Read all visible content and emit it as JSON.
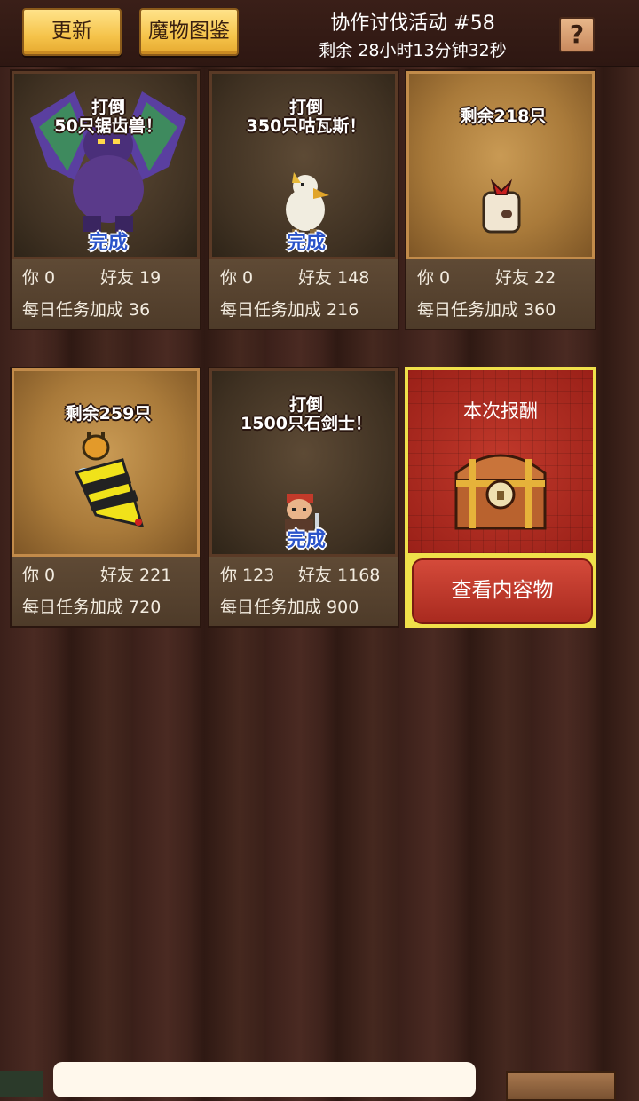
{
  "header": {
    "update_label": "更新",
    "bestiary_label": "魔物图鉴",
    "title": "协作讨伐活动 #58",
    "countdown": "剩余 28小时13分钟32秒",
    "help_label": "?"
  },
  "cards": [
    {
      "caption1": "打倒",
      "caption2": "50只锯齿兽！",
      "status": "完成",
      "you": "你 0",
      "friends": "好友  19",
      "bonus": "每日任务加成  36",
      "sprite": "purple-dragon-icon"
    },
    {
      "caption1": "打倒",
      "caption2": "350只咕瓦斯！",
      "status": "完成",
      "you": "你 0",
      "friends": "好友  148",
      "bonus": "每日任务加成  216",
      "sprite": "white-bird-icon"
    },
    {
      "caption1": "剩余218只",
      "you": "你 0",
      "friends": "好友  22",
      "bonus": "每日任务加成  360",
      "sprite": "sack-icon"
    },
    {
      "caption1": "剩余259只",
      "you": "你 0",
      "friends": "好友  221",
      "bonus": "每日任务加成  720",
      "sprite": "bee-icon"
    },
    {
      "caption1": "打倒",
      "caption2": "1500只石剑士！",
      "status": "完成",
      "you": "你 123",
      "friends": "好友  1168",
      "bonus": "每日任务加成  900",
      "sprite": "swordsman-icon"
    }
  ],
  "reward": {
    "title": "本次报酬",
    "button_label": "查看内容物"
  }
}
